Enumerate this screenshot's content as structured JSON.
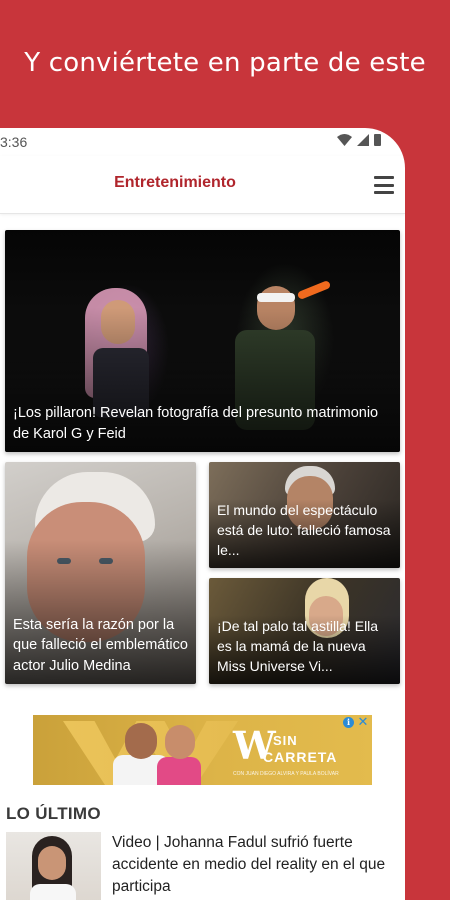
{
  "promo": {
    "text": "Y conviértete en parte de este"
  },
  "status_bar": {
    "time": "3:36"
  },
  "app_bar": {
    "title": "Entretenimiento"
  },
  "cards": [
    {
      "caption": "¡Los pillaron! Revelan fotografía del presunto matrimonio de Karol G y Feid"
    },
    {
      "caption": "Esta sería la razón por la que falleció el emblemático actor Julio Medina"
    },
    {
      "caption": "El mundo del espectáculo está de luto: falleció famosa le..."
    },
    {
      "caption": "¡De tal palo tal astilla! Ella es la mamá de la nueva Miss Universe Vi..."
    }
  ],
  "ad": {
    "brand_letter": "W",
    "brand_top": "SIN",
    "brand_bottom": "CARRETA",
    "byline": "CON JUAN DIEGO ALVIRA Y PAULA BOLÍVAR",
    "info_glyph": "i",
    "close_glyph": "✕"
  },
  "latest": {
    "section_title": "LO ÚLTIMO",
    "items": [
      {
        "headline": "Video | Johanna Fadul sufrió fuerte accidente en medio del reality en el que participa"
      }
    ]
  },
  "colors": {
    "brand_red": "#c8353b",
    "title_red": "#b0252c",
    "ad_gold": "#ddb448"
  }
}
